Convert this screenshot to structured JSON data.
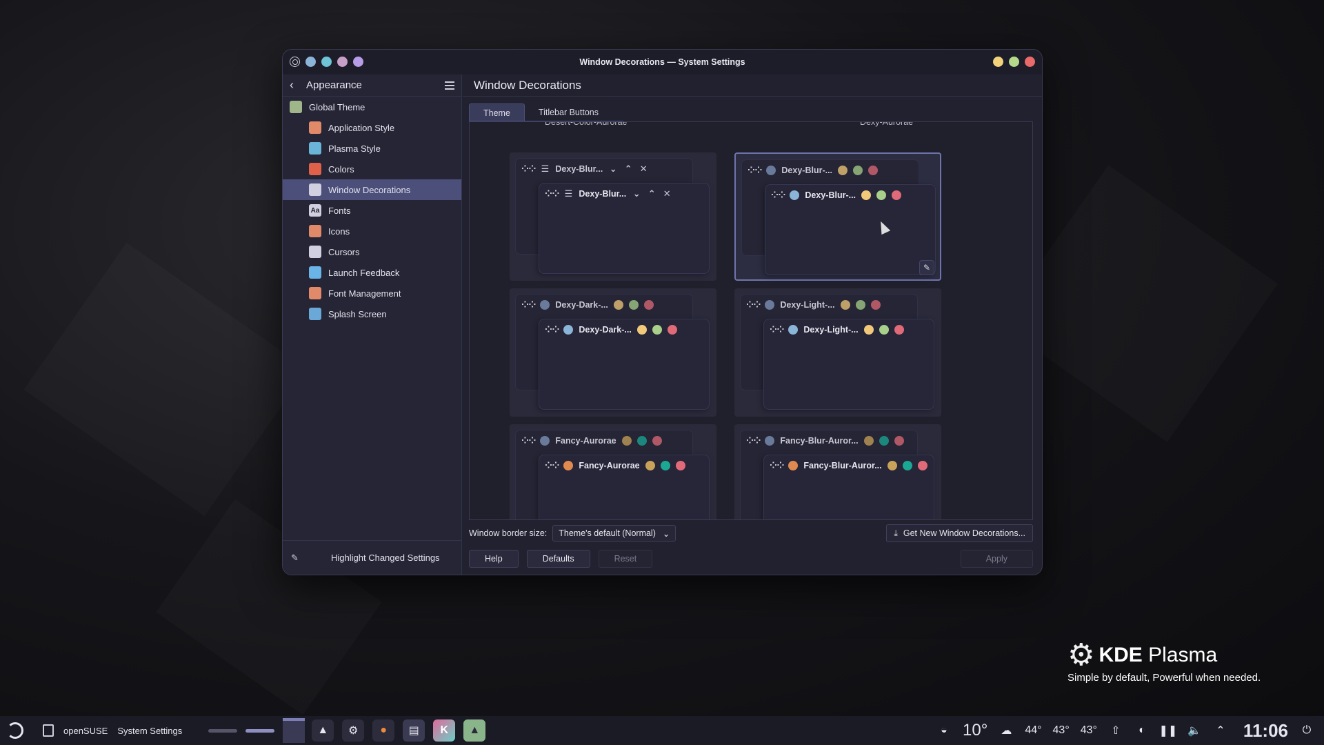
{
  "window": {
    "title": "Window Decorations — System Settings",
    "title_dots": [
      "#8ab4d8",
      "#6fc3d6",
      "#c7a0c8",
      "#b79ce6"
    ],
    "control_dots": [
      "#f2d27a",
      "#b4d98a",
      "#e86a6a"
    ]
  },
  "sidebar": {
    "back_label": "Appearance",
    "items": [
      {
        "label": "Global Theme",
        "icon": "global-theme-icon",
        "color": "#9fb68a"
      },
      {
        "label": "Application Style",
        "icon": "application-style-icon",
        "color": "#e08a6a"
      },
      {
        "label": "Plasma Style",
        "icon": "plasma-style-icon",
        "color": "#6ab4d8"
      },
      {
        "label": "Colors",
        "icon": "colors-icon",
        "color": "#e0604a"
      },
      {
        "label": "Window Decorations",
        "icon": "window-decorations-icon",
        "color": "#d0d0e0"
      },
      {
        "label": "Fonts",
        "icon": "fonts-icon",
        "color": "#d0d0e0",
        "glyph": "Aa"
      },
      {
        "label": "Icons",
        "icon": "icons-icon",
        "color": "#e08a6a"
      },
      {
        "label": "Cursors",
        "icon": "cursors-icon",
        "color": "#d0d0e0"
      },
      {
        "label": "Launch Feedback",
        "icon": "launch-feedback-icon",
        "color": "#6ab4e8"
      },
      {
        "label": "Font Management",
        "icon": "font-management-icon",
        "color": "#e08a6a"
      },
      {
        "label": "Splash Screen",
        "icon": "splash-screen-icon",
        "color": "#6aa8d8"
      }
    ],
    "footer_label": "Highlight Changed Settings"
  },
  "main": {
    "heading": "Window Decorations",
    "tabs": [
      {
        "label": "Theme",
        "active": true
      },
      {
        "label": "Titlebar Buttons",
        "active": false
      }
    ],
    "cut_labels": [
      "Desert-Color-Aurorae",
      "Dexy-Aurorae"
    ],
    "themes": [
      {
        "name": "Dexy-Blur-Aurorae",
        "preview_title": "Dexy-Blur...",
        "style": "symbols",
        "selected": false
      },
      {
        "name": "Dexy-Blur-Dark-Color-Aurorae",
        "preview_title": "Dexy-Blur-...",
        "style": "dots",
        "selected": true,
        "dots": [
          "#f2c97a",
          "#a8d08a",
          "#e06a78"
        ],
        "menu_dot": "#8ab4d8"
      },
      {
        "name": "Dexy-Dark-Color-Aurorae",
        "preview_title": "Dexy-Dark-...",
        "style": "dots",
        "selected": false,
        "dots": [
          "#f2c97a",
          "#a8d08a",
          "#e06a78"
        ],
        "menu_dot": "#8ab4d8"
      },
      {
        "name": "Dexy-Light-Color-Aurorae",
        "preview_title": "Dexy-Light-...",
        "style": "dots",
        "selected": false,
        "dots": [
          "#f2c97a",
          "#a8d08a",
          "#e06a78"
        ],
        "menu_dot": "#8ab4d8"
      },
      {
        "name": "Fancy-Aurorae",
        "preview_title": "Fancy-Aurorae",
        "style": "dots",
        "selected": false,
        "dots": [
          "#c9a25a",
          "#1aa894",
          "#e06a78"
        ],
        "menu_dot": "#e08a50"
      },
      {
        "name": "Fancy-Blur-Aurorae",
        "preview_title": "Fancy-Blur-Auror...",
        "style": "dots",
        "selected": false,
        "dots": [
          "#c9a25a",
          "#1aa894",
          "#e06a78"
        ],
        "menu_dot": "#e08a50"
      }
    ],
    "border_size_label": "Window border size:",
    "border_size_value": "Theme's default (Normal)",
    "get_new_label": "Get New Window Decorations...",
    "buttons": {
      "help": "Help",
      "defaults": "Defaults",
      "reset": "Reset",
      "apply": "Apply"
    }
  },
  "branding": {
    "name_bold": "KDE",
    "name_light": "Plasma",
    "tagline": "Simple by default, Powerful when  needed."
  },
  "taskbar": {
    "distro": "openSUSE",
    "active_app": "System Settings",
    "weather_temp": "10°",
    "temps": [
      "44°",
      "43°",
      "43°"
    ],
    "clock": "11:06"
  }
}
